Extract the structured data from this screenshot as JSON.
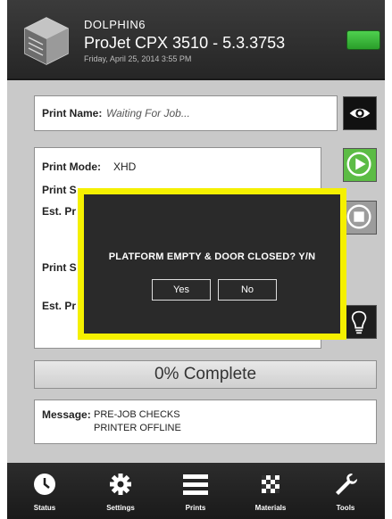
{
  "header": {
    "host_name": "DOLPHIN6",
    "model": "ProJet CPX 3510 - 5.3.3753",
    "datetime": "Friday, April 25, 2014 3:55 PM",
    "status_light_color": "#3cbf3c"
  },
  "print_name": {
    "label": "Print Name:",
    "value": "Waiting For Job..."
  },
  "info": {
    "print_mode_label": "Print Mode:",
    "print_mode_value": "XHD",
    "print_s_label": "Print S",
    "print_s_value": "...",
    "est_pr_label": "Est. Pr",
    "print_s2_label": "Print S",
    "est_pr2_label": "Est. Pr"
  },
  "side_buttons": {
    "view": "eye-icon",
    "start": "play-icon",
    "stop": "stop-icon",
    "light": "lightbulb-icon"
  },
  "progress": {
    "text": "0% Complete",
    "percent": 0
  },
  "message": {
    "label": "Message:",
    "lines": [
      "PRE-JOB CHECKS",
      "PRINTER OFFLINE"
    ]
  },
  "nav": {
    "items": [
      {
        "label": "Status",
        "icon": "clock-icon"
      },
      {
        "label": "Settings",
        "icon": "gear-icon"
      },
      {
        "label": "Prints",
        "icon": "list-icon"
      },
      {
        "label": "Materials",
        "icon": "checker-icon"
      },
      {
        "label": "Tools",
        "icon": "wrench-icon"
      }
    ]
  },
  "dialog": {
    "message": "PLATFORM EMPTY & DOOR CLOSED? Y/N",
    "yes_label": "Yes",
    "no_label": "No",
    "highlight_color": "#f5f000"
  }
}
